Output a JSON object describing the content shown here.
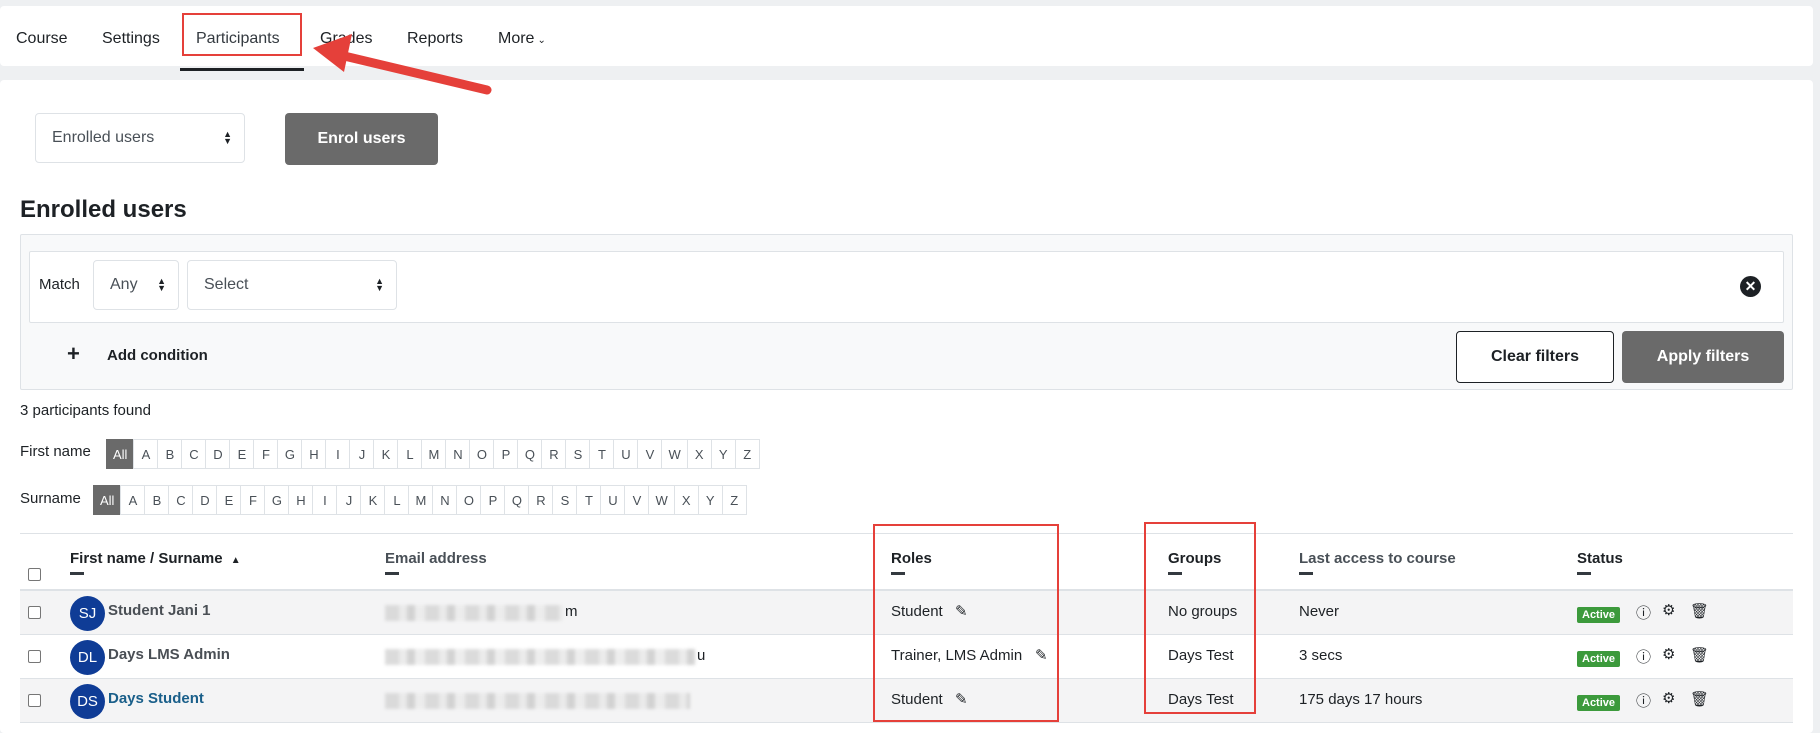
{
  "nav": {
    "tabs": [
      "Course",
      "Settings",
      "Participants",
      "Grades",
      "Reports",
      "More"
    ],
    "active_tab": "Participants"
  },
  "enrol_select": {
    "value": "Enrolled users"
  },
  "enrol_button": "Enrol users",
  "page_title": "Enrolled users",
  "filters": {
    "match_label": "Match",
    "match_value": "Any",
    "select_value": "Select",
    "add_condition": "Add condition",
    "clear": "Clear filters",
    "apply": "Apply filters"
  },
  "participants_found": "3 participants found",
  "initials": {
    "first_label": "First name",
    "surname_label": "Surname",
    "all": "All",
    "letters": [
      "A",
      "B",
      "C",
      "D",
      "E",
      "F",
      "G",
      "H",
      "I",
      "J",
      "K",
      "L",
      "M",
      "N",
      "O",
      "P",
      "Q",
      "R",
      "S",
      "T",
      "U",
      "V",
      "W",
      "X",
      "Y",
      "Z"
    ]
  },
  "table": {
    "headers": {
      "first": "First name",
      "sep": " / ",
      "surname": "Surname",
      "email": "Email address",
      "roles": "Roles",
      "groups": "Groups",
      "last_access": "Last access to course",
      "status": "Status"
    },
    "rows": [
      {
        "initials": "SJ",
        "name": "Student Jani 1",
        "email_tail": "m",
        "roles": "Student",
        "groups": "No groups",
        "last_access": "Never",
        "status": "Active"
      },
      {
        "initials": "DL",
        "name": "Days LMS Admin",
        "email_tail": "u",
        "roles": "Trainer, LMS Admin",
        "groups": "Days Test",
        "last_access": "3 secs",
        "status": "Active"
      },
      {
        "initials": "DS",
        "name": "Days Student",
        "email_tail": "",
        "roles": "Student",
        "groups": "Days Test",
        "last_access": "175 days 17 hours",
        "status": "Active"
      }
    ]
  },
  "colors": {
    "highlight": "#e5403a",
    "avatar": "#0f3c96",
    "active_badge": "#3c9a3c",
    "button_dark": "#6a6a6a"
  }
}
